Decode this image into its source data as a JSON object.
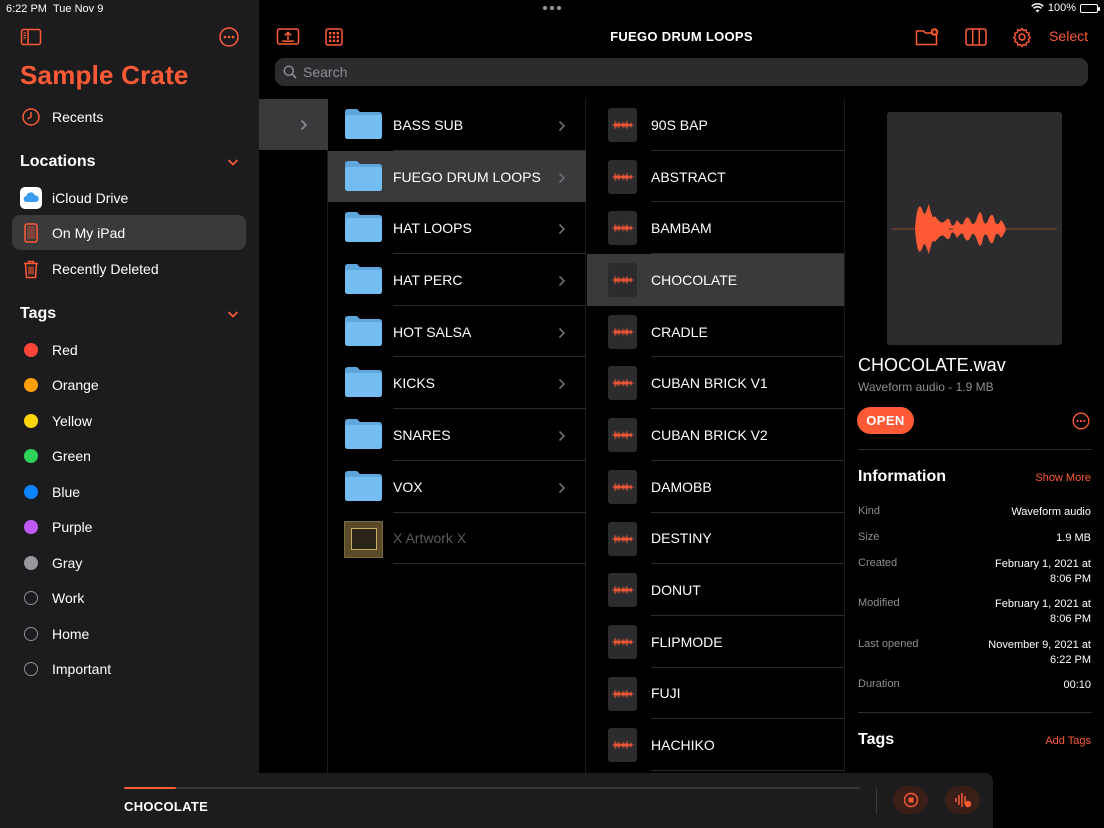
{
  "status_bar": {
    "time": "6:22 PM",
    "date": "Tue Nov 9",
    "battery": "100%"
  },
  "colors": {
    "accent": "#ff5a36",
    "background": "#000000",
    "sidebar": "#1c1c1e",
    "selection": "#3a3a3c",
    "folder": "#6fb5e8"
  },
  "sidebar": {
    "app_title": "Sample Crate",
    "recents_label": "Recents",
    "locations_heading": "Locations",
    "locations": [
      {
        "label": "iCloud Drive",
        "icon": "cloud-icon"
      },
      {
        "label": "On My iPad",
        "icon": "ipad-icon",
        "selected": true
      },
      {
        "label": "Recently Deleted",
        "icon": "trash-icon"
      }
    ],
    "tags_heading": "Tags",
    "tags": [
      {
        "label": "Red",
        "color": "#ff453a"
      },
      {
        "label": "Orange",
        "color": "#ff9f0a"
      },
      {
        "label": "Yellow",
        "color": "#ffd60a"
      },
      {
        "label": "Green",
        "color": "#30d158"
      },
      {
        "label": "Blue",
        "color": "#0a84ff"
      },
      {
        "label": "Purple",
        "color": "#bf5af2"
      },
      {
        "label": "Gray",
        "color": "#98989d"
      },
      {
        "label": "Work",
        "color": ""
      },
      {
        "label": "Home",
        "color": ""
      },
      {
        "label": "Important",
        "color": ""
      }
    ]
  },
  "toolbar": {
    "title": "FUEGO DRUM LOOPS",
    "select_label": "Select"
  },
  "search": {
    "placeholder": "Search"
  },
  "folders": [
    {
      "label": "BASS SUB"
    },
    {
      "label": "FUEGO DRUM LOOPS",
      "selected": true
    },
    {
      "label": "HAT LOOPS"
    },
    {
      "label": "HAT PERC"
    },
    {
      "label": "HOT SALSA"
    },
    {
      "label": "KICKS"
    },
    {
      "label": "SNARES"
    },
    {
      "label": "VOX"
    },
    {
      "label": "X Artwork X",
      "dimmed": true
    }
  ],
  "files": [
    {
      "label": "90S BAP"
    },
    {
      "label": "ABSTRACT"
    },
    {
      "label": "BAMBAM"
    },
    {
      "label": "CHOCOLATE",
      "selected": true
    },
    {
      "label": "CRADLE"
    },
    {
      "label": "CUBAN BRICK V1"
    },
    {
      "label": "CUBAN BRICK V2"
    },
    {
      "label": "DAMOBB"
    },
    {
      "label": "DESTINY"
    },
    {
      "label": "DONUT"
    },
    {
      "label": "FLIPMODE"
    },
    {
      "label": "FUJI"
    },
    {
      "label": "HACHIKO"
    }
  ],
  "preview": {
    "file_name": "CHOCOLATE.wav",
    "subtitle": "Waveform audio - 1.9 MB",
    "open_label": "OPEN",
    "information_heading": "Information",
    "show_more_label": "Show More",
    "info": [
      {
        "key": "Kind",
        "value": "Waveform audio"
      },
      {
        "key": "Size",
        "value": "1.9 MB"
      },
      {
        "key": "Created",
        "value": "February 1, 2021 at 8:06 PM"
      },
      {
        "key": "Modified",
        "value": "February 1, 2021 at 8:06 PM"
      },
      {
        "key": "Last opened",
        "value": "November 9, 2021 at 6:22 PM"
      },
      {
        "key": "Duration",
        "value": "00:10"
      }
    ],
    "tags_heading": "Tags",
    "add_tags_label": "Add Tags"
  },
  "player": {
    "title": "CHOCOLATE",
    "progress": 0.07
  }
}
